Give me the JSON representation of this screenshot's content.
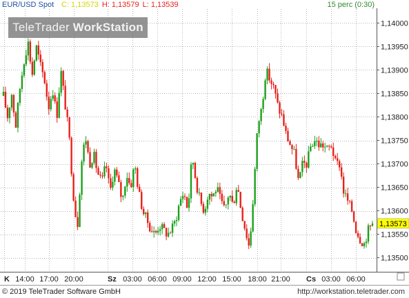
{
  "header": {
    "symbol": "EUR/USD Spot",
    "close_label": "C: 1,13573",
    "high_label": "H: 1,13579",
    "low_label": "L: 1,13539",
    "period": "15 perc (0:30)"
  },
  "watermark": {
    "brand_light": "TeleTrader",
    "brand_bold": "WorkStation"
  },
  "footer": {
    "copyright": "© 2019 TeleTrader Software GmbH",
    "website": "http://workstation.teletrader.com"
  },
  "colors": {
    "up": "#1aa01a",
    "down": "#e8201a",
    "grid": "#b4b4b4",
    "last_price_bg": "#ffff00",
    "header_close": "#d4d400",
    "header_high_low": "#e8201a",
    "symbol": "#1f4fa0",
    "period": "#2e8b2e"
  },
  "chart_data": {
    "type": "candlestick",
    "symbol": "EUR/USD Spot",
    "interval": "15 perc",
    "ylim": [
      1.1347,
      1.1403
    ],
    "y_ticks": [
      "1,14000",
      "1,13950",
      "1,13900",
      "1,13850",
      "1,13800",
      "1,13750",
      "1,13700",
      "1,13650",
      "1,13600",
      "1,13550",
      "1,13500"
    ],
    "y_tick_values": [
      1.14,
      1.1395,
      1.139,
      1.1385,
      1.138,
      1.1375,
      1.137,
      1.1365,
      1.136,
      1.1355,
      1.135
    ],
    "x_ticks": [
      "K",
      "14:00",
      "17:00",
      "20:00",
      "Sz",
      "03:00",
      "06:00",
      "09:00",
      "12:00",
      "15:00",
      "18:00",
      "21:00",
      "Cs",
      "03:00",
      "06:00"
    ],
    "x_tick_bold": [
      true,
      false,
      false,
      false,
      true,
      false,
      false,
      false,
      false,
      false,
      false,
      false,
      true,
      false,
      false
    ],
    "last_price": "1,13573",
    "last_price_value": 1.13573,
    "grid": true,
    "close_path": [
      1.13845,
      1.138,
      1.1385,
      1.1378,
      1.1386,
      1.1392,
      1.1396,
      1.1389,
      1.1395,
      1.1391,
      1.1388,
      1.1382,
      1.1386,
      1.138,
      1.139,
      1.1383,
      1.1376,
      1.1364,
      1.1356,
      1.137,
      1.1376,
      1.137,
      1.1372,
      1.1368,
      1.1366,
      1.137,
      1.1364,
      1.1369,
      1.1366,
      1.1362,
      1.1368,
      1.1365,
      1.137,
      1.1364,
      1.136,
      1.1358,
      1.1356,
      1.1355,
      1.1357,
      1.1356,
      1.1355,
      1.1356,
      1.1358,
      1.1362,
      1.1364,
      1.136,
      1.1372,
      1.1366,
      1.1362,
      1.136,
      1.1364,
      1.1363,
      1.1365,
      1.1362,
      1.136,
      1.1364,
      1.1361,
      1.1366,
      1.136,
      1.1356,
      1.1352,
      1.1364,
      1.1378,
      1.1382,
      1.139,
      1.1388,
      1.1386,
      1.1382,
      1.138,
      1.1376,
      1.1374,
      1.1372,
      1.1366,
      1.137,
      1.137,
      1.1374,
      1.1375,
      1.1374,
      1.1374,
      1.1373,
      1.1374,
      1.137,
      1.137,
      1.1364,
      1.1362,
      1.136,
      1.1356,
      1.1354,
      1.1353,
      1.1356,
      1.13573
    ]
  }
}
